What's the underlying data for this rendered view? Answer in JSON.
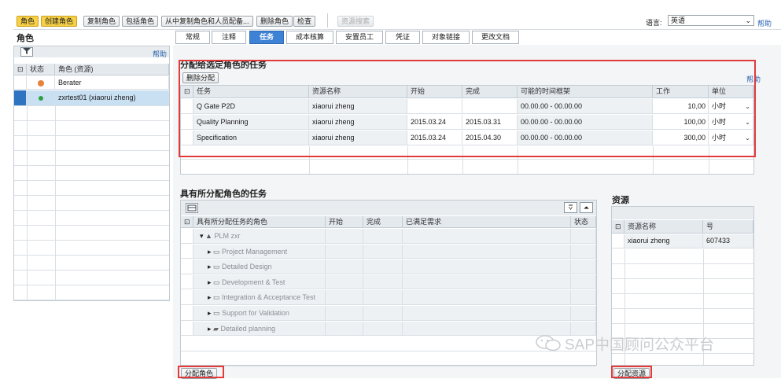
{
  "toolbar": {
    "role": "角色",
    "create_role": "创建角色",
    "copy_role": "复制角色",
    "delete_role": "包括角色",
    "create_from_project": "从中复制角色和人员配备...",
    "delete": "删除角色",
    "check": "检查",
    "resource_search": "资源搜索",
    "language_label": "语言:",
    "language_value": "英语",
    "help": "帮助"
  },
  "left": {
    "title": "角色",
    "help": "帮助",
    "headers": {
      "status": "状态",
      "role": "角色 (资源)"
    },
    "rows": [
      {
        "role": "Berater",
        "status": "orange"
      },
      {
        "role": "zxrtest01 (xiaorui zheng)",
        "status": "green"
      }
    ]
  },
  "tabs": [
    "常规",
    "注释",
    "任务",
    "成本核算",
    "安置员工",
    "凭证",
    "对象链接",
    "更改文档"
  ],
  "assigned": {
    "title": "分配给选定角色的任务",
    "delete_btn": "删除分配",
    "help": "帮助",
    "headers": [
      "任务",
      "资源名称",
      "开始",
      "完成",
      "可能的时间框架",
      "工作",
      "单位"
    ],
    "rows": [
      {
        "task": "Q Gate P2D",
        "resource": "xiaorui zheng",
        "start": "",
        "finish": "",
        "frame": "00.00.00 - 00.00.00",
        "work": "10,00",
        "unit": "小时"
      },
      {
        "task": "Quality Planning",
        "resource": "xiaorui zheng",
        "start": "2015.03.24",
        "finish": "2015.03.31",
        "frame": "00.00.00 - 00.00.00",
        "work": "100,00",
        "unit": "小时"
      },
      {
        "task": "Specification",
        "resource": "xiaorui zheng",
        "start": "2015.03.24",
        "finish": "2015.04.30",
        "frame": "00.00.00 - 00.00.00",
        "work": "300,00",
        "unit": "小时"
      }
    ]
  },
  "unassigned": {
    "title": "具有所分配角色的任务",
    "headers": [
      "具有所分配任务的角色",
      "开始",
      "完成",
      "已满足需求",
      "状态"
    ],
    "tree": [
      {
        "label": "PLM zxr",
        "level": 0
      },
      {
        "label": "Project Management",
        "level": 1
      },
      {
        "label": "Detailed Design",
        "level": 1
      },
      {
        "label": "Development & Test",
        "level": 1
      },
      {
        "label": "Integration & Acceptance Test",
        "level": 1
      },
      {
        "label": "Support for Validation",
        "level": 1
      },
      {
        "label": "Detailed planning",
        "level": 1
      }
    ],
    "assign_role_btn": "分配角色"
  },
  "resources": {
    "title": "资源",
    "headers": [
      "资源名称",
      "号"
    ],
    "rows": [
      {
        "name": "xiaorui zheng",
        "number": "607433"
      }
    ],
    "assign_btn": "分配资源"
  },
  "watermark": "SAP中国顾问公众平台"
}
